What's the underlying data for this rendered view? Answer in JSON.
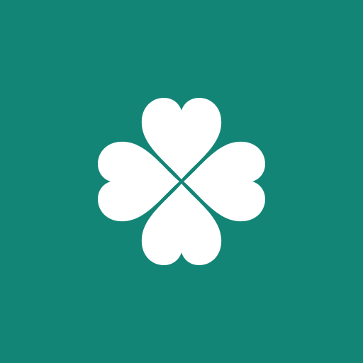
{
  "app_icon": {
    "icon": "four-leaf-clover-icon",
    "background_color": "#138576",
    "foreground_color": "#ffffff"
  }
}
